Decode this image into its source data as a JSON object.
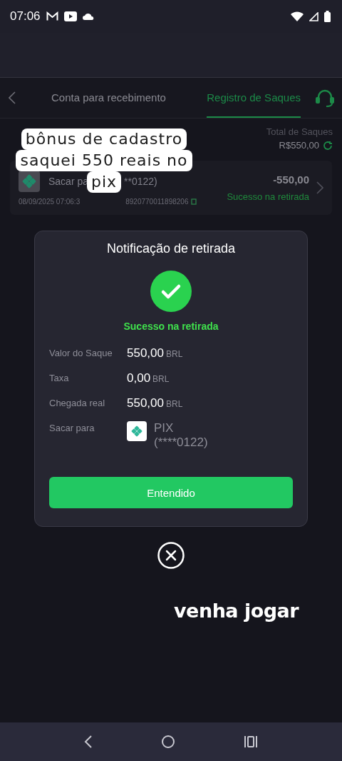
{
  "status_bar": {
    "time": "07:06"
  },
  "tabs": [
    {
      "label": "Conta para recebimento",
      "selected": false
    },
    {
      "label": "Registro de Saques",
      "selected": true
    }
  ],
  "summary": {
    "label": "Total de Saques",
    "amount": "R$550,00"
  },
  "records": [
    {
      "title_start": "Sacar pa",
      "title_end": "**0122)",
      "datetime": "08/09/2025 07:06:3",
      "order_id": "8920770011898206",
      "amount": "-550,00",
      "status": "Sucesso na retirada"
    }
  ],
  "modal": {
    "title": "Notificação de retirada",
    "status": "Sucesso na retirada",
    "rows": [
      {
        "kind": "amount",
        "label": "Valor do Saque",
        "value": "550,00",
        "currency": "BRL"
      },
      {
        "kind": "amount",
        "label": "Taxa",
        "value": "0,00",
        "currency": "BRL"
      },
      {
        "kind": "amount",
        "label": "Chegada real",
        "value": "550,00",
        "currency": "BRL"
      },
      {
        "kind": "method",
        "label": "Sacar para",
        "method": "PIX",
        "account": "(****0122)"
      }
    ],
    "button": "Entendido"
  },
  "captions": [
    {
      "kind": "boxed",
      "lines": [
        "bônus de cadastro",
        "saquei 550 reais no",
        "pix"
      ]
    },
    {
      "kind": "plain",
      "text": "venha jogar"
    }
  ]
}
